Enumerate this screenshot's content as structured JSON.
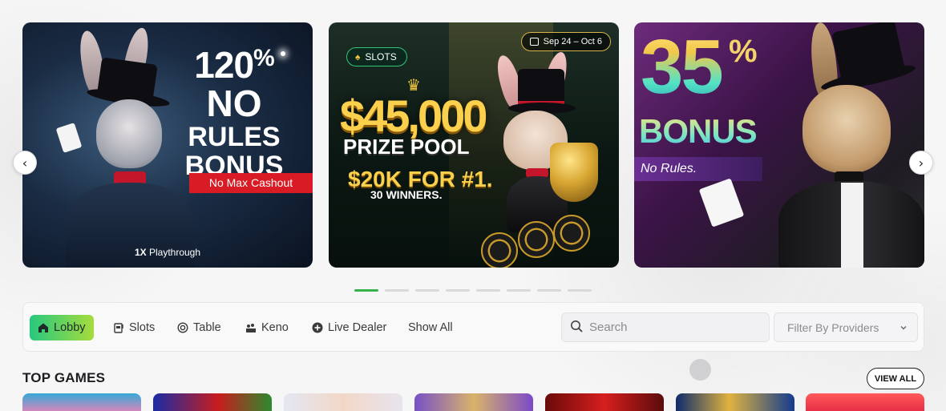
{
  "carousel": {
    "slide1": {
      "percent": "120",
      "percent_sign": "%",
      "line_no": "NO",
      "line_rules": "RULES",
      "line_bonus": "BONUS",
      "ribbon": "No Max Cashout",
      "playthrough_bold": "1X",
      "playthrough_text": "Playthrough"
    },
    "slide2": {
      "tag": "SLOTS",
      "date_range": "Sep 24 – Oct 6",
      "amount": "$45,000",
      "prize_pool": "PRIZE POOL",
      "first_prize": "$20K FOR #1.",
      "winners": "30 WINNERS."
    },
    "slide3": {
      "percent": "35",
      "percent_sign": "%",
      "bonus": "BONUS",
      "no_rules": "No Rules."
    },
    "prev_icon": "chevron-left-icon",
    "next_icon": "chevron-right-icon",
    "dots_count": 8,
    "active_dot": 0
  },
  "filters": {
    "categories": [
      {
        "label": "Lobby",
        "icon": "home-icon"
      },
      {
        "label": "Slots",
        "icon": "slot-machine-icon"
      },
      {
        "label": "Table",
        "icon": "chip-icon"
      },
      {
        "label": "Keno",
        "icon": "keno-icon"
      },
      {
        "label": "Live Dealer",
        "icon": "plus-circle-icon"
      },
      {
        "label": "Show All",
        "icon": ""
      }
    ],
    "active_category": "Lobby",
    "search_placeholder": "Search",
    "provider_placeholder": "Filter By Providers"
  },
  "top_games": {
    "title": "TOP GAMES",
    "view_all": "VIEW ALL"
  },
  "colors": {
    "accent_green": "#36b34a",
    "lobby_gradient_start": "#27c87f",
    "lobby_gradient_end": "#a6dc3c",
    "ribbon_red": "#d81b24",
    "gold": "#fbd04c"
  }
}
